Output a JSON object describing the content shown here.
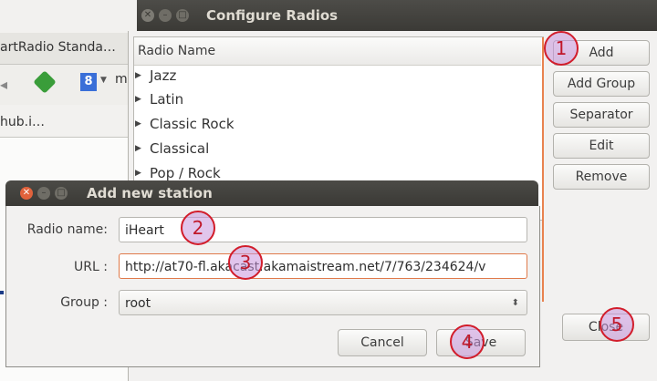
{
  "browser": {
    "tab_title": "artRadio Standa…",
    "bookmark_text": "hub.i…",
    "search_engine_letter": "8",
    "search_text": "m"
  },
  "configure_window": {
    "title": "Configure Radios",
    "column_header": "Radio Name",
    "tree_items": [
      "Jazz",
      "Latin",
      "Classic Rock",
      "Classical",
      "Pop / Rock"
    ],
    "buttons": {
      "add": "Add",
      "add_group": "Add Group",
      "separator": "Separator",
      "edit": "Edit",
      "remove": "Remove",
      "close": "Close"
    }
  },
  "dialog": {
    "title": "Add new station",
    "radio_name_label": "Radio name:",
    "radio_name_value": "iHeart",
    "url_label": "URL :",
    "url_value": "http://at70-fl.akacast.akamaistream.net/7/763/234624/v",
    "group_label": "Group :",
    "group_value": "root",
    "cancel_label": "Cancel",
    "save_label": "Save"
  },
  "annotations": [
    "1",
    "2",
    "3",
    "4",
    "5"
  ],
  "colors": {
    "titlebar": "#3c3b37",
    "focus_accent": "#e07a4a",
    "annotation_ring": "#d21d2b",
    "annotation_fill": "#c896dc"
  }
}
